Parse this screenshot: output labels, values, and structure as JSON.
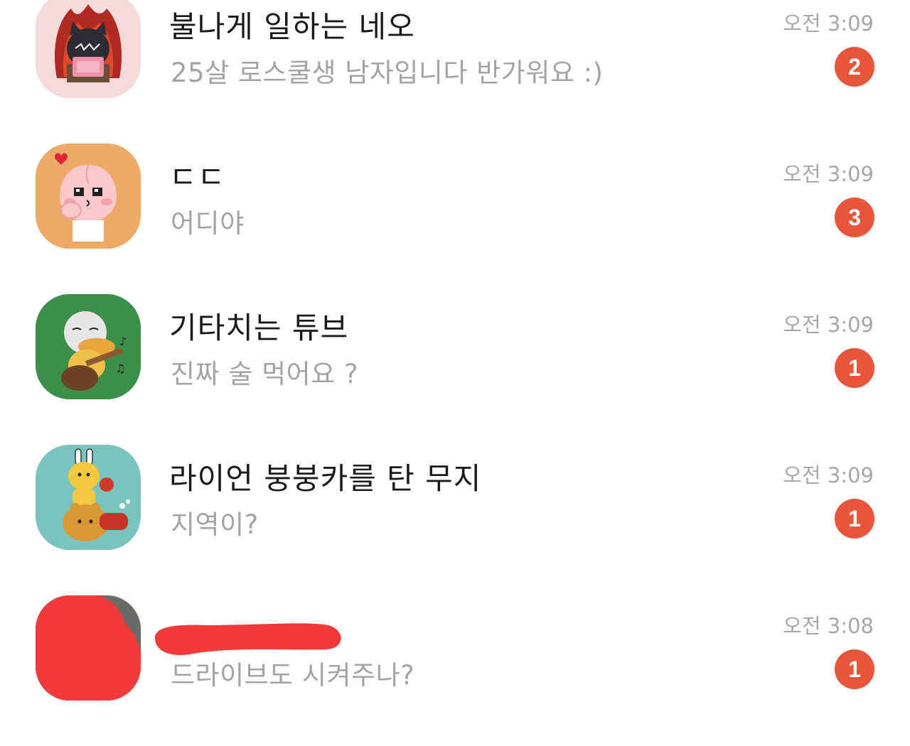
{
  "chats": [
    {
      "avatar": "neo-cat-laptop-avatar",
      "avatar_color": "#f6dadb",
      "name": "불나게 일하는 네오",
      "message": "25살 로스쿨생 남자입니다 반가워요 :)",
      "time": "오전 3:09",
      "unread": "2"
    },
    {
      "avatar": "apeach-avatar",
      "avatar_color": "#eda967",
      "name": "ㄷㄷ",
      "message": "어디야",
      "time": "오전 3:09",
      "unread": "3"
    },
    {
      "avatar": "tube-guitar-avatar",
      "avatar_color": "#3c8e48",
      "name": "기타치는 튜브",
      "message": "진짜 술 먹어요 ?",
      "time": "오전 3:09",
      "unread": "1"
    },
    {
      "avatar": "ryan-muzi-scooter-avatar",
      "avatar_color": "#7bc4bd",
      "name": "라이언 붕붕카를 탄 무지",
      "message": "지역이?",
      "time": "오전 3:09",
      "unread": "1"
    },
    {
      "avatar": "redacted-avatar",
      "avatar_color": "#f23a3a",
      "name": "",
      "message": "드라이브도 시켜주나?",
      "time": "오전 3:08",
      "unread": "1"
    }
  ],
  "colors": {
    "badge": "#e9553b",
    "time": "#a7a7a7",
    "message": "#a3a3a3",
    "name": "#1a1a1a",
    "redaction": "#f23a3a"
  }
}
